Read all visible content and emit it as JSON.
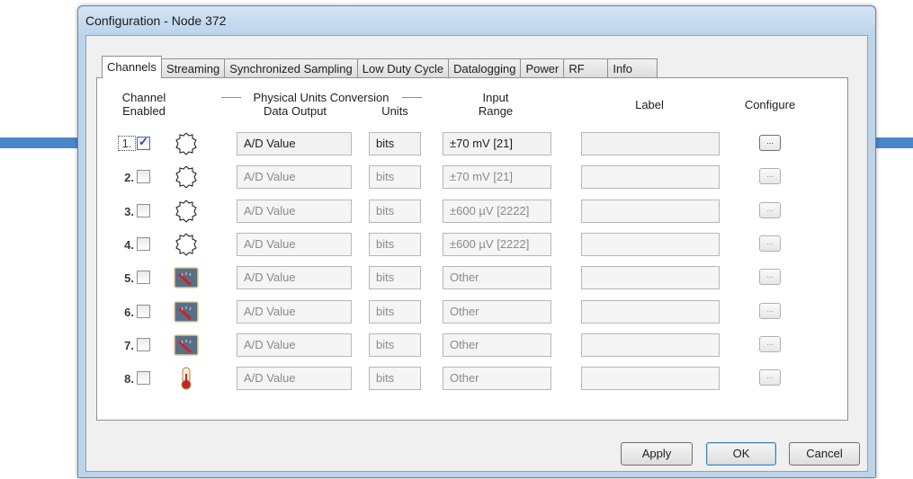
{
  "window": {
    "title": "Configuration - Node 372"
  },
  "tabs": [
    {
      "label": "Channels",
      "active": true
    },
    {
      "label": "Streaming"
    },
    {
      "label": "Synchronized Sampling"
    },
    {
      "label": "Low Duty Cycle"
    },
    {
      "label": "Datalogging"
    },
    {
      "label": "Power"
    },
    {
      "label": "RF"
    },
    {
      "label": "Info"
    }
  ],
  "header": {
    "channel_enabled_1": "Channel",
    "channel_enabled_2": "Enabled",
    "conversion_group": "Physical Units Conversion",
    "data_output": "Data Output",
    "units": "Units",
    "input_range_1": "Input",
    "input_range_2": "Range",
    "label": "Label",
    "configure": "Configure"
  },
  "channels": [
    {
      "num": "1.",
      "checked": true,
      "icon": "differential-sensor-icon",
      "data_output": "A/D Value",
      "units": "bits",
      "input_range": "±70 mV [21]",
      "label": "",
      "configure": "..."
    },
    {
      "num": "2.",
      "checked": false,
      "icon": "differential-sensor-icon",
      "data_output": "A/D Value",
      "units": "bits",
      "input_range": "±70 mV [21]",
      "label": "",
      "configure": "..."
    },
    {
      "num": "3.",
      "checked": false,
      "icon": "differential-sensor-icon",
      "data_output": "A/D Value",
      "units": "bits",
      "input_range": "±600 µV [2222]",
      "label": "",
      "configure": "..."
    },
    {
      "num": "4.",
      "checked": false,
      "icon": "differential-sensor-icon",
      "data_output": "A/D Value",
      "units": "bits",
      "input_range": "±600 µV [2222]",
      "label": "",
      "configure": "..."
    },
    {
      "num": "5.",
      "checked": false,
      "icon": "analog-gauge-icon",
      "data_output": "A/D Value",
      "units": "bits",
      "input_range": "Other",
      "label": "",
      "configure": "..."
    },
    {
      "num": "6.",
      "checked": false,
      "icon": "analog-gauge-icon",
      "data_output": "A/D Value",
      "units": "bits",
      "input_range": "Other",
      "label": "",
      "configure": "..."
    },
    {
      "num": "7.",
      "checked": false,
      "icon": "analog-gauge-icon",
      "data_output": "A/D Value",
      "units": "bits",
      "input_range": "Other",
      "label": "",
      "configure": "..."
    },
    {
      "num": "8.",
      "checked": false,
      "icon": "thermometer-icon",
      "data_output": "A/D Value",
      "units": "bits",
      "input_range": "Other",
      "label": "",
      "configure": "..."
    }
  ],
  "buttons": {
    "apply": "Apply",
    "ok": "OK",
    "cancel": "Cancel"
  },
  "colors": {
    "arrow": "#4a86c8",
    "title_bar": "#bcd3ea",
    "gauge_bg": "#5a6e86",
    "gauge_needle": "#c8232c"
  }
}
